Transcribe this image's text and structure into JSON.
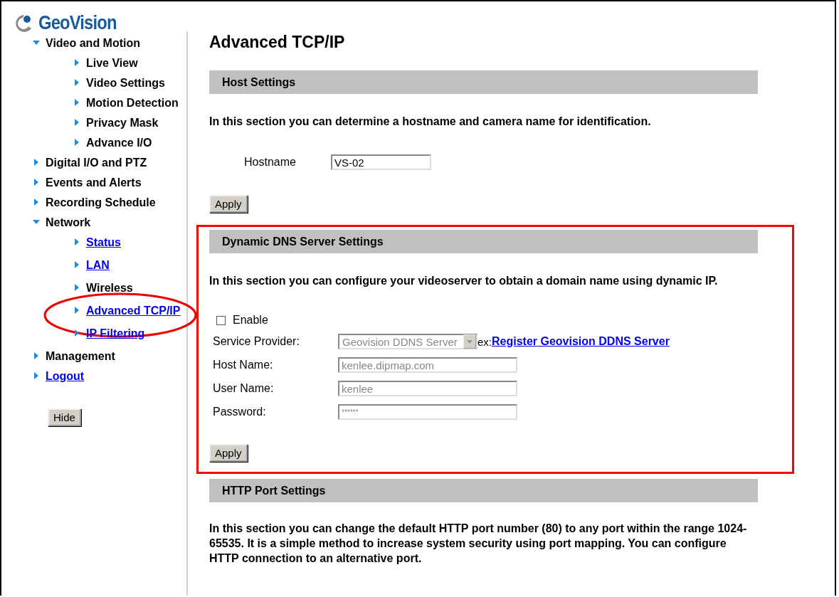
{
  "logo": {
    "text": "GeoVision"
  },
  "sidebar": {
    "items": [
      {
        "label": "Video and Motion",
        "link": false,
        "expanded": true,
        "children": [
          {
            "label": "Live View",
            "link": false
          },
          {
            "label": "Video Settings",
            "link": false
          },
          {
            "label": "Motion Detection",
            "link": false
          },
          {
            "label": "Privacy Mask",
            "link": false
          },
          {
            "label": "Advance I/O",
            "link": false
          }
        ]
      },
      {
        "label": "Digital I/O and PTZ",
        "link": false,
        "expanded": false
      },
      {
        "label": "Events and Alerts",
        "link": false,
        "expanded": false
      },
      {
        "label": "Recording Schedule",
        "link": false,
        "expanded": false
      },
      {
        "label": "Network",
        "link": false,
        "expanded": true,
        "children": [
          {
            "label": "Status",
            "link": true
          },
          {
            "label": "LAN",
            "link": true
          },
          {
            "label": "Wireless",
            "link": false
          },
          {
            "label": "Advanced TCP/IP",
            "link": true,
            "highlighted": true
          },
          {
            "label": "IP Filtering",
            "link": true
          }
        ]
      },
      {
        "label": "Management",
        "link": false,
        "expanded": false
      },
      {
        "label": "Logout",
        "link": true,
        "expanded": false
      }
    ],
    "hide_button": "Hide"
  },
  "page_title": "Advanced TCP/IP",
  "sections": [
    {
      "kind": "inline-form",
      "title": "Host Settings",
      "highlighted": false,
      "description": "In this section you can determine a hostname and camera name for identification.",
      "fields": [
        {
          "kind": "text",
          "label": "Hostname",
          "value": "VS-02",
          "disabled": false
        }
      ],
      "button": "Apply"
    },
    {
      "kind": "grid-form",
      "title": "Dynamic DNS Server Settings",
      "highlighted": true,
      "description": "In this section you can configure your videoserver to obtain a domain name using dynamic IP.",
      "enable": {
        "label": "Enable",
        "checked": false
      },
      "fields": [
        {
          "kind": "select",
          "label": "Service Provider:",
          "value": "Geovision DDNS Server",
          "disabled": true,
          "hint": "ex:",
          "link": "Register Geovision DDNS Server"
        },
        {
          "kind": "text",
          "label": "Host Name:",
          "value": "kenlee.dipmap.com",
          "disabled": true
        },
        {
          "kind": "text",
          "label": "User Name:",
          "value": "kenlee",
          "disabled": true
        },
        {
          "kind": "password",
          "label": "Password:",
          "value": "******",
          "disabled": true
        }
      ],
      "button": "Apply"
    },
    {
      "kind": "text",
      "title": "HTTP Port Settings",
      "highlighted": false,
      "description": "In this section you can change the default HTTP port number (80) to any port within the range 1024-65535. It is a simple method to increase system security using port mapping. You can configure HTTP connection to an alternative port."
    }
  ]
}
